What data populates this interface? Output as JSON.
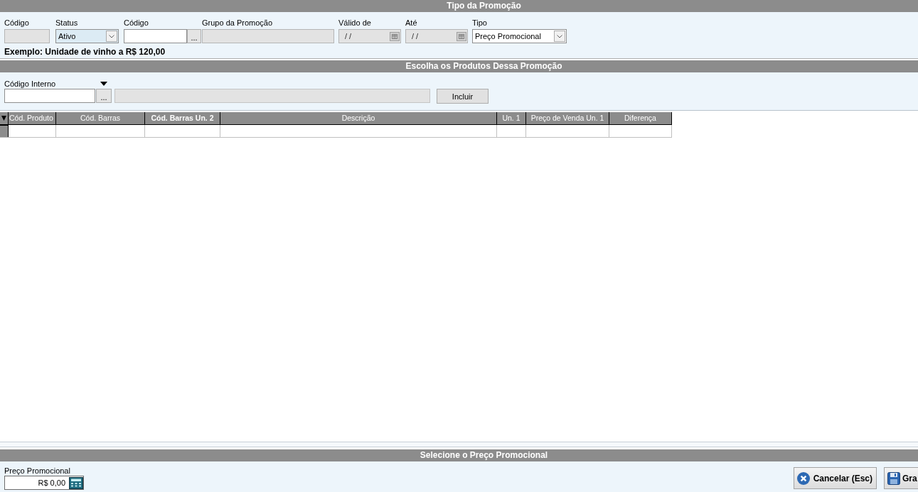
{
  "promotion_type": {
    "title": "Tipo da Promoção",
    "fields": [
      {
        "kind": "text",
        "label": "Código",
        "disabled": true,
        "focused": false
      },
      {
        "kind": "select",
        "label": "Status",
        "value": "Ativo",
        "disabled": false,
        "focused": true
      },
      {
        "kind": "lookup",
        "label": "Código",
        "button": "...",
        "disabled": false,
        "focused": false
      },
      {
        "kind": "text",
        "label": "Grupo da Promoção",
        "disabled": true,
        "focused": false
      },
      {
        "kind": "date",
        "label": "Válido de",
        "value": "/ /",
        "disabled": true,
        "focused": false
      },
      {
        "kind": "date",
        "label": "Até",
        "value": "/ /",
        "disabled": true,
        "focused": false
      },
      {
        "kind": "select",
        "label": "Tipo",
        "value": "Preço Promocional",
        "disabled": false,
        "focused": false
      }
    ],
    "example": "Exemplo: Unidade de vinho a R$ 120,00"
  },
  "products": {
    "title": "Escolha os Produtos Dessa Promoção",
    "search": {
      "label": "Código Interno",
      "lookup_button": "..."
    },
    "add_button": "Incluir",
    "table": {
      "columns": [
        {
          "label": "Cód. Produto",
          "highlighted": false
        },
        {
          "label": "Cód. Barras",
          "highlighted": false
        },
        {
          "label": "Cód. Barras Un. 2",
          "highlighted": true
        },
        {
          "label": "Descrição",
          "highlighted": false
        },
        {
          "label": "Un. 1",
          "highlighted": false
        },
        {
          "label": "Preço de Venda Un. 1",
          "highlighted": false
        },
        {
          "label": "Diferença",
          "highlighted": false
        }
      ],
      "rows": [
        {
          "kind": "blank"
        }
      ]
    }
  },
  "promotional_price": {
    "title": "Selecione o Preço Promocional",
    "field": {
      "label": "Preço Promocional",
      "value": "R$ 0,00"
    },
    "buttons": [
      {
        "kind": "cancel",
        "label": "Cancelar (Esc)"
      },
      {
        "kind": "save",
        "label": "Gra"
      }
    ]
  }
}
